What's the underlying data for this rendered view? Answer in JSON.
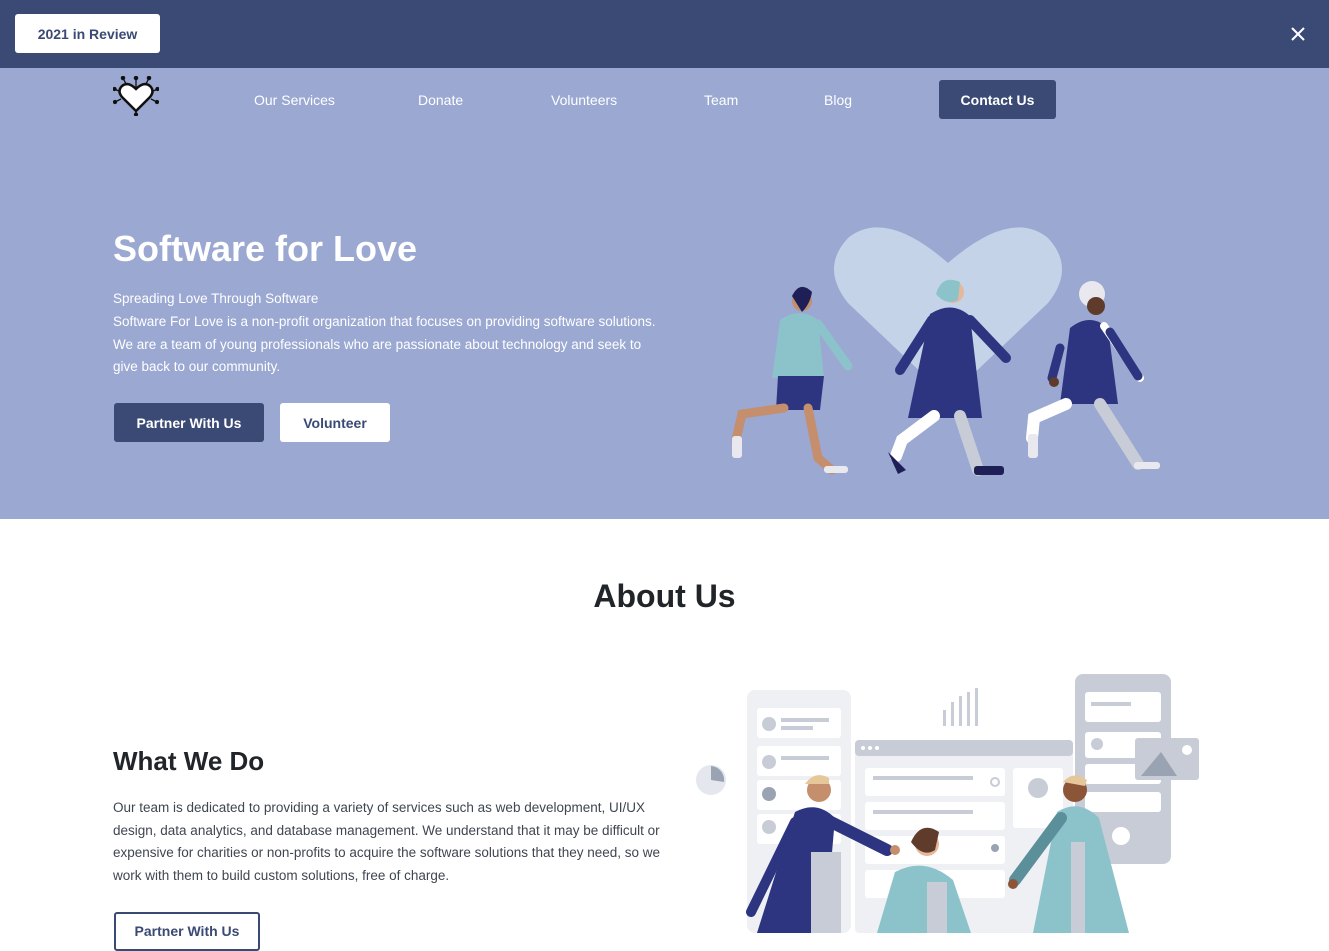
{
  "banner": {
    "review_button": "2021 in Review",
    "close_icon": "close-icon",
    "background": "#3a4a74"
  },
  "nav": {
    "logo_icon": "heart-circuit-logo-icon",
    "links": [
      "Our Services",
      "Donate",
      "Volunteers",
      "Team",
      "Blog"
    ],
    "contact_button": "Contact Us"
  },
  "hero": {
    "title": "Software for Love",
    "subtitle": "Spreading Love Through Software",
    "description": "Software For Love is a non-profit organization that focuses on providing software solutions. We are a team of young professionals who are passionate about technology and seek to give back to our community.",
    "partner_button": "Partner With Us",
    "volunteer_button": "Volunteer",
    "background": "#9aa8d2",
    "illustration": "people-walking-with-heart-illustration"
  },
  "about": {
    "title": "About Us",
    "what_we_do": {
      "title": "What We Do",
      "description": "Our team is dedicated to providing a variety of services such as web development, UI/UX design, data analytics, and database management. We understand that it may be difficult or expensive for charities or non-profits to acquire the software solutions that they need, so we work with them to build custom solutions, free of charge.",
      "partner_button": "Partner With Us",
      "illustration": "team-building-dashboard-illustration"
    }
  },
  "colors": {
    "primary": "#3a4a74",
    "hero_bg": "#9aa8d2",
    "accent_teal": "#8cc3cb",
    "accent_navy": "#2e3580"
  }
}
